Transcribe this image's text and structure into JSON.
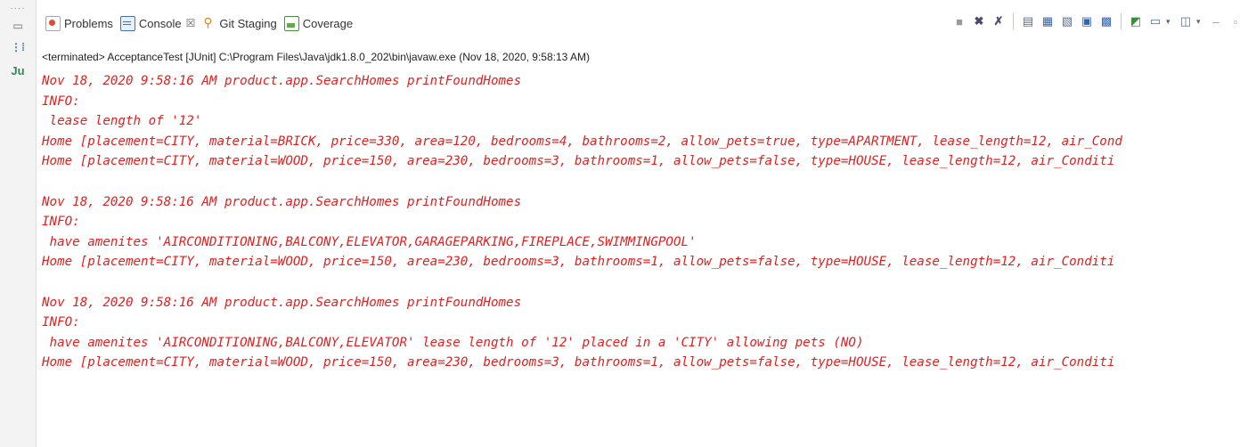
{
  "tabs": [
    {
      "label": "Problems",
      "icon": "problems-icon",
      "active": false
    },
    {
      "label": "Console",
      "icon": "console-icon",
      "active": true,
      "close": "☒"
    },
    {
      "label": "Git Staging",
      "icon": "git-staging-icon",
      "active": false
    },
    {
      "label": "Coverage",
      "icon": "coverage-icon",
      "active": false
    }
  ],
  "status_line": "<terminated> AcceptanceTest [JUnit] C:\\Program Files\\Java\\jdk1.8.0_202\\bin\\javaw.exe (Nov 18, 2020, 9:58:13 AM)",
  "console_color": "#e51e1e",
  "console_lines": [
    "Nov 18, 2020 9:58:16 AM product.app.SearchHomes printFoundHomes",
    "INFO:",
    " lease length of '12'",
    "Home [placement=CITY, material=BRICK, price=330, area=120, bedrooms=4, bathrooms=2, allow_pets=true, type=APARTMENT, lease_length=12, air_Cond",
    "Home [placement=CITY, material=WOOD, price=150, area=230, bedrooms=3, bathrooms=1, allow_pets=false, type=HOUSE, lease_length=12, air_Conditi",
    "",
    "Nov 18, 2020 9:58:16 AM product.app.SearchHomes printFoundHomes",
    "INFO:",
    " have amenites 'AIRCONDITIONING,BALCONY,ELEVATOR,GARAGEPARKING,FIREPLACE,SWIMMINGPOOL'",
    "Home [placement=CITY, material=WOOD, price=150, area=230, bedrooms=3, bathrooms=1, allow_pets=false, type=HOUSE, lease_length=12, air_Conditi",
    "",
    "Nov 18, 2020 9:58:16 AM product.app.SearchHomes printFoundHomes",
    "INFO:",
    " have amenites 'AIRCONDITIONING,BALCONY,ELEVATOR' lease length of '12' placed in a 'CITY' allowing pets (NO)",
    "Home [placement=CITY, material=WOOD, price=150, area=230, bedrooms=3, bathrooms=1, allow_pets=false, type=HOUSE, lease_length=12, air_Conditi"
  ]
}
